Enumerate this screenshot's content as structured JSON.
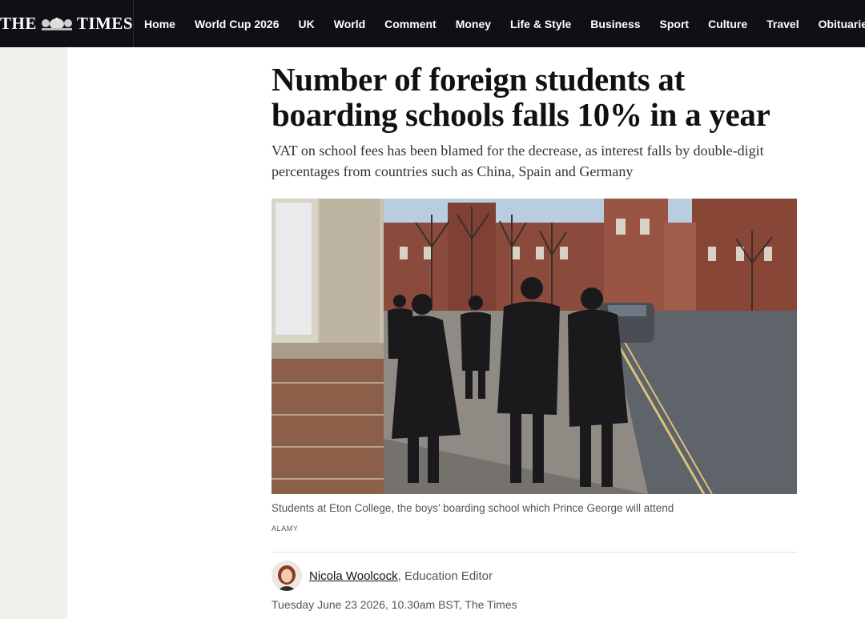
{
  "header": {
    "logo_left": "THE",
    "logo_right": "TIMES",
    "nav": [
      "Home",
      "World Cup 2026",
      "UK",
      "World",
      "Comment",
      "Money",
      "Life & Style",
      "Business",
      "Sport",
      "Culture",
      "Travel",
      "Obituaries"
    ]
  },
  "article": {
    "headline": "Number of foreign students at boarding schools falls 10% in a year",
    "standfirst": "VAT on school fees has been blamed for the decrease, as interest falls by double-digit percentages from countries such as China, Spain and Germany",
    "image": {
      "caption": "Students at Eton College, the boys’ boarding school which Prince George will attend",
      "credit": "ALAMY"
    },
    "author": {
      "name": "Nicola Woolcock",
      "role": ", Education Editor"
    },
    "dateline": "Tuesday June 23 2026, 10.30am BST, The Times"
  },
  "colors": {
    "nav_background": "#0f0f14",
    "left_rail": "#f2f0ec"
  }
}
